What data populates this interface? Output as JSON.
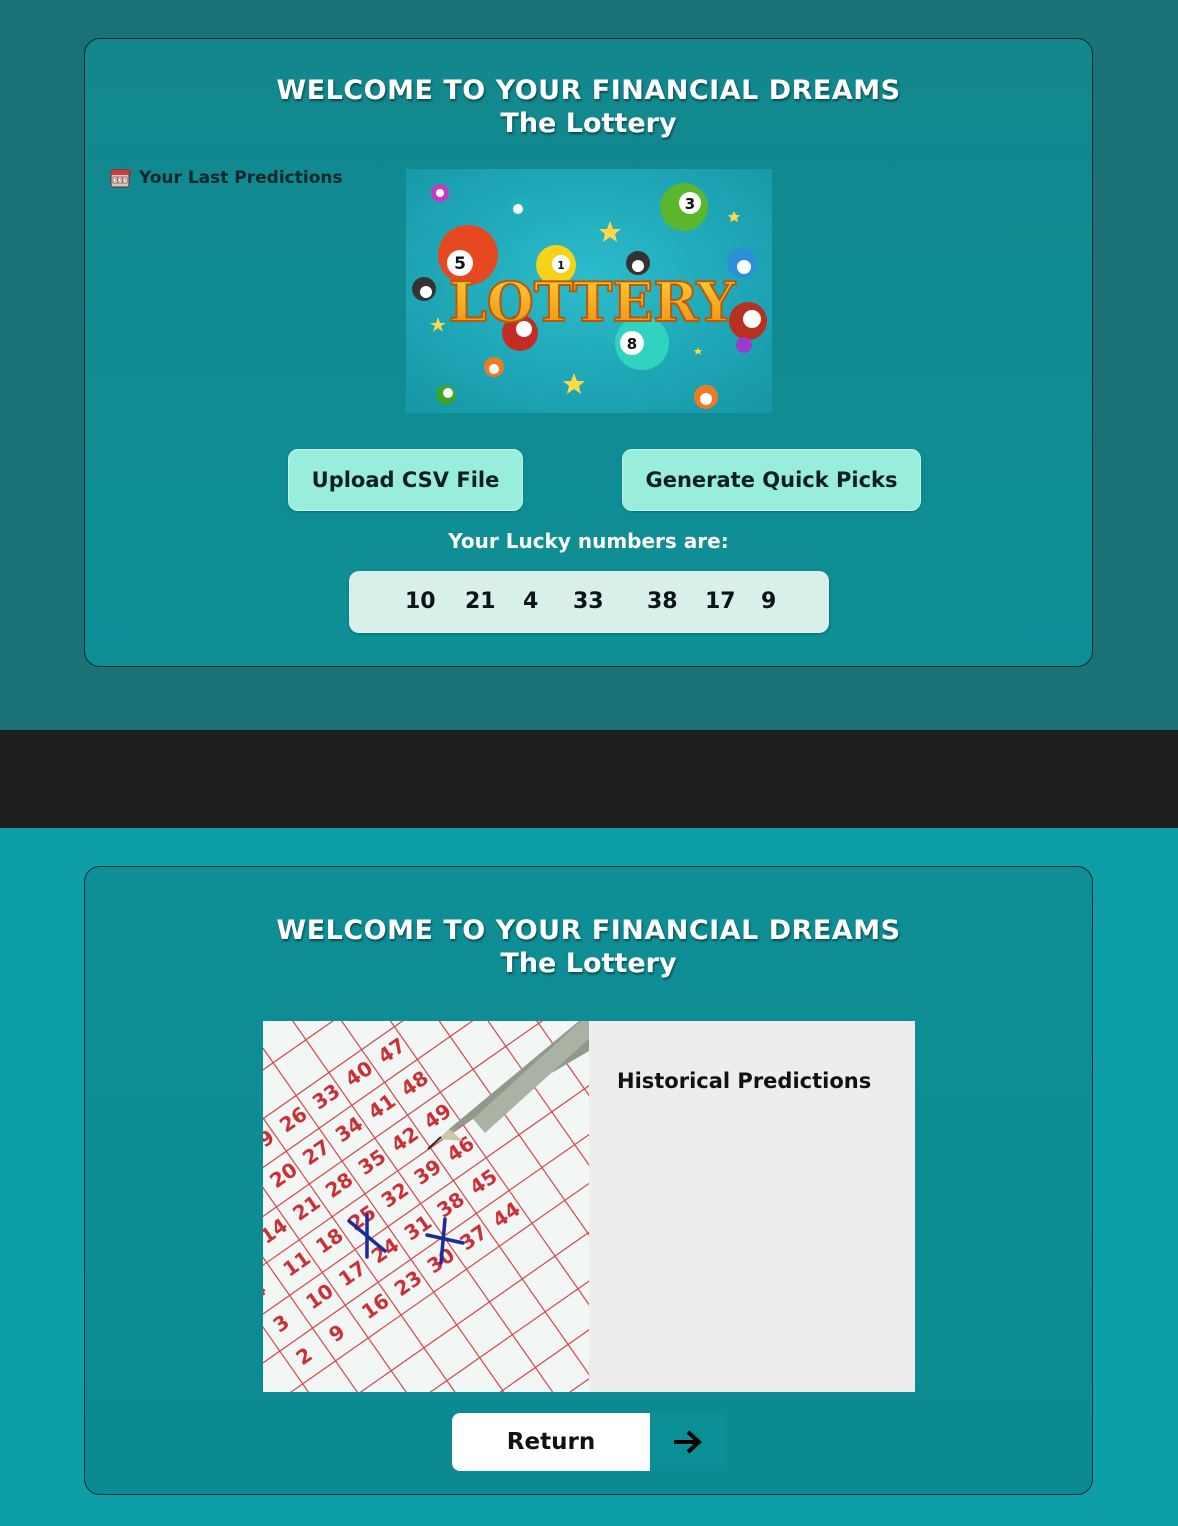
{
  "top": {
    "heading_line1": "WELCOME TO YOUR FINANCIAL DREAMS",
    "heading_line2": "The Lottery",
    "last_predictions_label": "Your Last Predictions",
    "last_predictions_icon": "slot-machine-icon",
    "hero_image_text": "LOTTERY",
    "upload_button": "Upload CSV File",
    "generate_button": "Generate Quick Picks",
    "lucky_label": "Your Lucky numbers are:",
    "lucky_numbers": [
      "10",
      "21",
      "4",
      "33",
      "38",
      "17",
      "9"
    ]
  },
  "bottom": {
    "heading_line1": "WELCOME TO YOUR FINANCIAL DREAMS",
    "heading_line2": "The Lottery",
    "historical_title": "Historical Predictions",
    "return_button": "Return",
    "return_icon": "arrow-right-icon"
  },
  "colors": {
    "top_background": "#1a7176",
    "divider_band": "#1f1f1f",
    "bottom_background": "#0e9ea8",
    "button_background": "#98eedb",
    "numbers_box": "#d9efea"
  }
}
